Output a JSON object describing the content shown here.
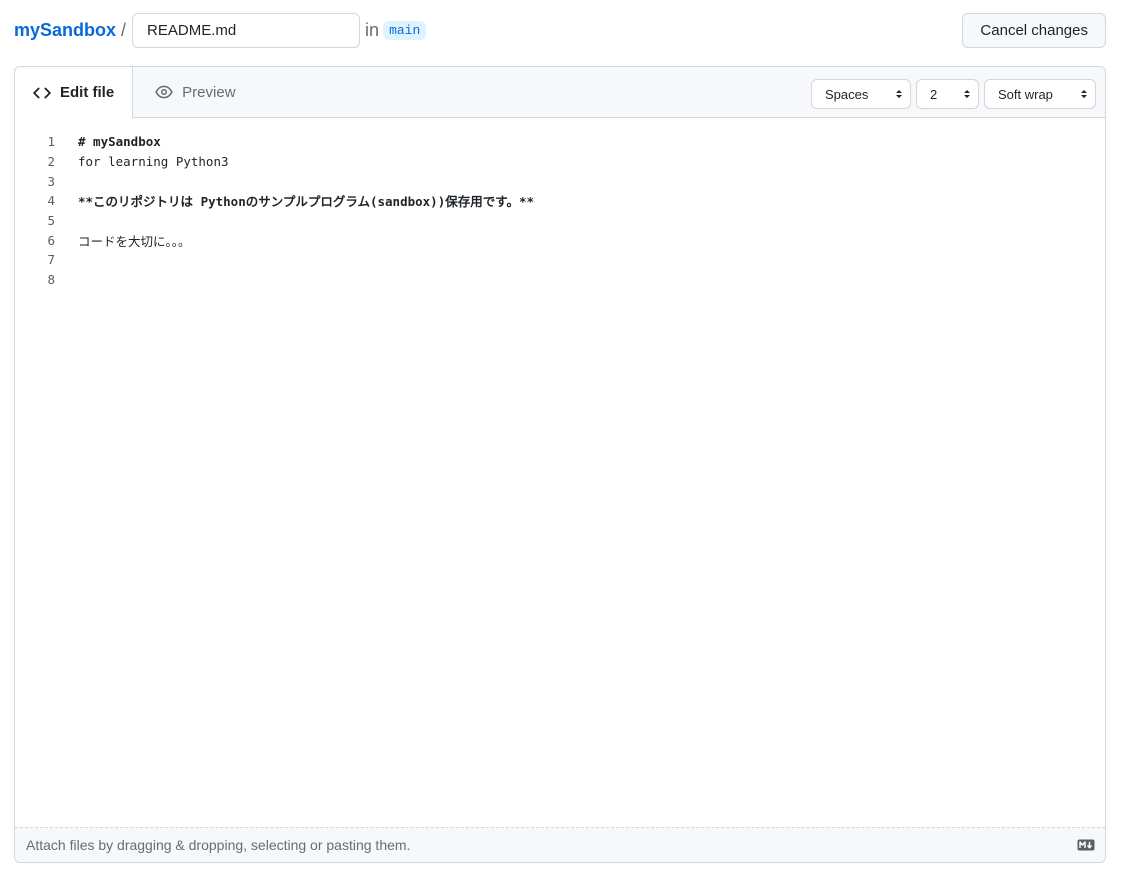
{
  "breadcrumb": {
    "repo": "mySandbox",
    "separator": "/",
    "filename": "README.md",
    "in_text": "in",
    "branch": "main"
  },
  "header": {
    "cancel_label": "Cancel changes"
  },
  "tabs": [
    {
      "label": "Edit file",
      "icon": "code-icon",
      "active": true
    },
    {
      "label": "Preview",
      "icon": "eye-icon",
      "active": false
    }
  ],
  "controls": {
    "indent_mode": "Spaces",
    "indent_size": "2",
    "wrap_mode": "Soft wrap"
  },
  "editor": {
    "lines": [
      {
        "num": "1",
        "text": "# mySandbox",
        "bold": true
      },
      {
        "num": "2",
        "text": "for learning Python3",
        "bold": false
      },
      {
        "num": "3",
        "text": "",
        "bold": false
      },
      {
        "num": "4",
        "text": "**このリポジトリは Pythonのサンプルプログラム(sandbox))保存用です。**",
        "bold": true
      },
      {
        "num": "5",
        "text": "",
        "bold": false
      },
      {
        "num": "6",
        "text": "コードを大切に。。。",
        "bold": false
      },
      {
        "num": "7",
        "text": "",
        "bold": false
      },
      {
        "num": "8",
        "text": "",
        "bold": false
      }
    ]
  },
  "footer": {
    "attach_text": "Attach files by dragging & dropping, selecting or pasting them.",
    "icon": "markdown-icon"
  }
}
